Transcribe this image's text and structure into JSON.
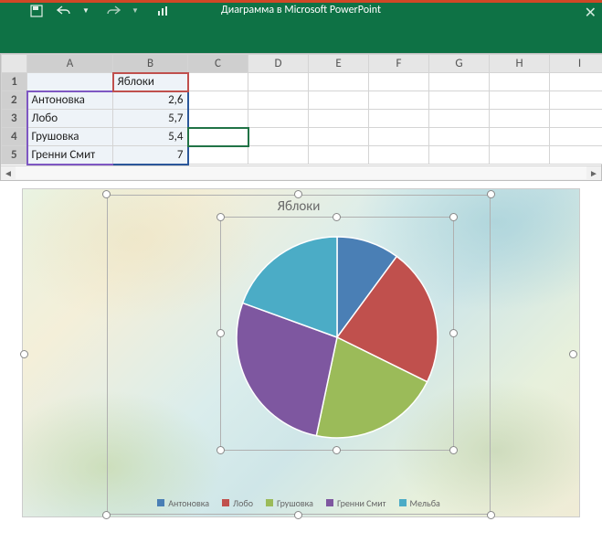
{
  "window": {
    "title": "Диаграмма в Microsoft PowerPoint"
  },
  "columns": [
    "A",
    "B",
    "C",
    "D",
    "E",
    "F",
    "G",
    "H",
    "I"
  ],
  "rows": [
    {
      "n": "1",
      "a": "",
      "b_header": "Яблоки"
    },
    {
      "n": "2",
      "a": "Антоновка",
      "b": "2,6"
    },
    {
      "n": "3",
      "a": "Лобо",
      "b": "5,7"
    },
    {
      "n": "4",
      "a": "Грушовка",
      "b": "5,4"
    },
    {
      "n": "5",
      "a": "Гренни Смит",
      "b": "7"
    }
  ],
  "chart_data": {
    "type": "pie",
    "title": "Яблоки",
    "series": [
      {
        "name": "Антоновка",
        "value": 2.6,
        "color": "#4a7fb5"
      },
      {
        "name": "Лобо",
        "value": 5.7,
        "color": "#c0504d"
      },
      {
        "name": "Грушовка",
        "value": 5.4,
        "color": "#9bbb59"
      },
      {
        "name": "Гренни Смит",
        "value": 7.0,
        "color": "#7e57a0"
      },
      {
        "name": "Мельба",
        "value": 5.0,
        "color": "#4bacc6"
      }
    ]
  },
  "legend_labels": {
    "l0": "Антоновка",
    "l1": "Лобо",
    "l2": "Грушовка",
    "l3": "Гренни Смит",
    "l4": "Мельба"
  },
  "colors": {
    "c0": "#4a7fb5",
    "c1": "#c0504d",
    "c2": "#9bbb59",
    "c3": "#7e57a0",
    "c4": "#4bacc6"
  }
}
